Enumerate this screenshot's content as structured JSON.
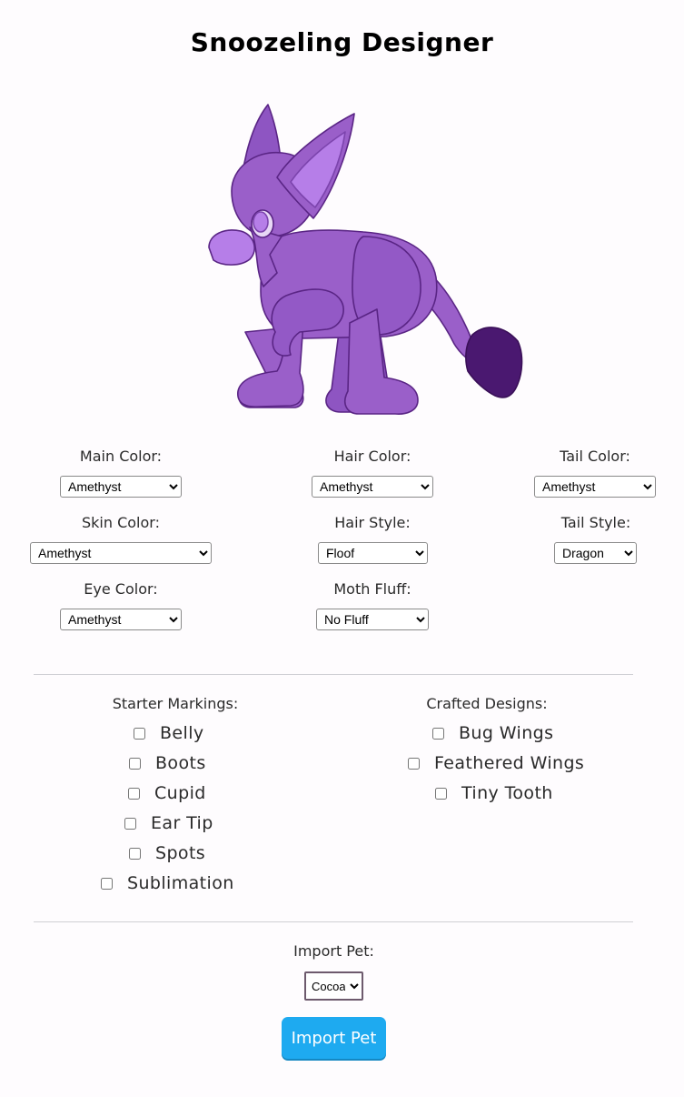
{
  "page": {
    "title": "Snoozeling Designer"
  },
  "colors": {
    "fur": "#9a5fc9",
    "fur_dark": "#7c44ad",
    "inner_ear": "#b67ee8",
    "tail_tuft": "#4a1870",
    "outline": "#5a2585",
    "button": "#1eaaf0"
  },
  "pet_image": {
    "icon": "snoozeling-pet-illustration"
  },
  "fields": {
    "main_color": {
      "label": "Main Color:",
      "value": "Amethyst"
    },
    "hair_color": {
      "label": "Hair Color:",
      "value": "Amethyst"
    },
    "tail_color": {
      "label": "Tail Color:",
      "value": "Amethyst"
    },
    "skin_color": {
      "label": "Skin Color:",
      "value": "Amethyst"
    },
    "hair_style": {
      "label": "Hair Style:",
      "value": "Floof"
    },
    "tail_style": {
      "label": "Tail Style:",
      "value": "Dragon"
    },
    "eye_color": {
      "label": "Eye Color:",
      "value": "Amethyst"
    },
    "moth_fluff": {
      "label": "Moth Fluff:",
      "value": "No Fluff"
    }
  },
  "starter_markings": {
    "heading": "Starter Markings:",
    "items": [
      "Belly",
      "Boots",
      "Cupid",
      "Ear Tip",
      "Spots",
      "Sublimation"
    ]
  },
  "crafted_designs": {
    "heading": "Crafted Designs:",
    "items": [
      "Bug Wings",
      "Feathered Wings",
      "Tiny Tooth"
    ]
  },
  "import": {
    "label": "Import Pet:",
    "selected": "Cocoa",
    "button": "Import Pet"
  }
}
